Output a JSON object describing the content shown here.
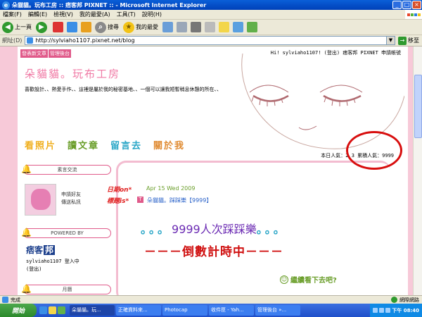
{
  "window": {
    "title": "朵貓貓。玩布工房 :: 痞客邦 PIXNET :: - Microsoft Internet Explorer",
    "minimize": "_",
    "maximize": "□",
    "close": "×"
  },
  "menu": [
    "檔案(F)",
    "編輯(E)",
    "檢視(V)",
    "我的最愛(A)",
    "工具(T)",
    "說明(H)"
  ],
  "toolbar": {
    "back_label": "上一頁",
    "search_label": "搜尋",
    "favorites_label": "我的最愛"
  },
  "address": {
    "label": "網址(D)",
    "url": "http://sylviaho1107.pixnet.net/blog",
    "go_label": "移至"
  },
  "blog": {
    "top_buttons": [
      "發表新文章",
      "管理後台"
    ],
    "welcome": "Hi! sylviaho1107! (登出) 痞客邦 PIXNET 申請帳號",
    "title": "朵貓貓。玩布工房",
    "description": "喜歡設計、、熱愛手作、、這裡是屬於我的秘密基地、、一個可以讓我短暫稍息休憩的所在、、",
    "nav": [
      {
        "label": "看照片",
        "color": "#f0b020"
      },
      {
        "label": "讀文章",
        "color": "#6a9e2a"
      },
      {
        "label": "留言去",
        "color": "#2aa6c7"
      },
      {
        "label": "關於我",
        "color": "#e08a30"
      }
    ],
    "stats": "本日人氣：2 3 累積人氣：9999",
    "sidebar": {
      "widget1": "素言交流",
      "widget1_text_1": "申請好友",
      "widget1_text_2": "傳送私訊",
      "widget2": "POWERED BY",
      "logo_text": "痞客",
      "logo_box": "邦",
      "user_line1": "sylviaho1107 登入中",
      "user_line2": "(登出)",
      "widget3": "月曆"
    },
    "post": {
      "date_label": "日期on*",
      "date_value": "Apr 15 Wed 2009",
      "title_label": "標題is*",
      "title_icon": "T",
      "title_category": "朵貓貓。踩踩樂【9999】",
      "headline_dots": "。。。",
      "headline_text": "9999人次踩踩樂",
      "headline_dots_end": "。。。",
      "countdown": "－－－倒數計時中－－－",
      "continue": "繼續看下去吧?"
    }
  },
  "status": {
    "text": "完成",
    "zone": "網際網路"
  },
  "taskbar": {
    "start": "開始",
    "tasks": [
      "朵貓貓。玩...",
      "正確資料來...",
      "Photocap",
      "收件匣 - Yah...",
      "管理後台 »..."
    ],
    "active_task": 0,
    "time": "下午 08:40"
  }
}
